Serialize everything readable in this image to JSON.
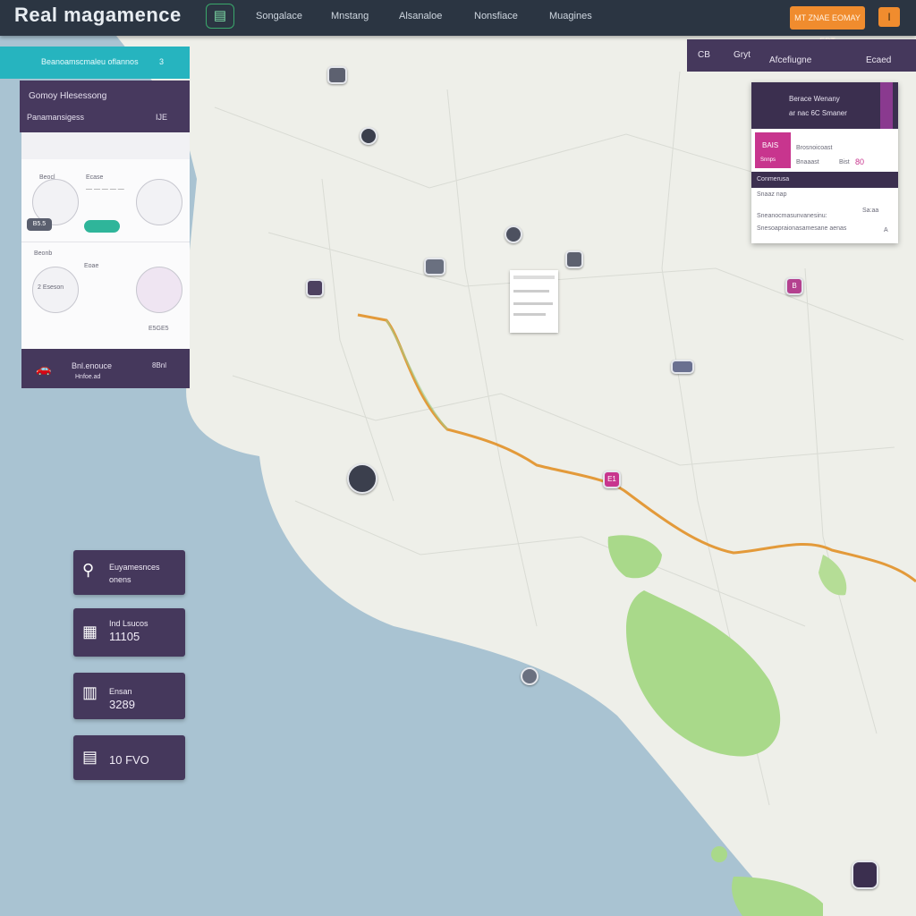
{
  "header": {
    "brand": "Real magamence",
    "nav": [
      "Songalace",
      "Mnstang",
      "Alsanaloe",
      "Nonsfiace",
      "Muagines"
    ],
    "cta_label": "MT ZNAE EOMAY ERT",
    "secondary_label": "I"
  },
  "left_panel": {
    "header_text": "Beanoamscmaleu oflannos",
    "header_num": "3",
    "title": "Gomoy Hlesessong",
    "subtitle": "Panamansigess",
    "subtitle_num": "IJE",
    "row1_text": "Beocl",
    "row1_item": "Ecase",
    "badge_label": "B5.5",
    "row2_text": "Beonb",
    "row2_item": "Eoae",
    "card_value1": "2 Eseson",
    "card_value2": "E5GE5",
    "footer_title": "Bnl.enouce",
    "footer_num": "8Bnl",
    "footer_sub": "Hnfoe.ad"
  },
  "stats": [
    {
      "icon": "map-pin-icon",
      "label": "Euyamesnces",
      "value": "onens"
    },
    {
      "icon": "store-icon",
      "label": "Ind Lsucos",
      "value": "11105"
    },
    {
      "icon": "calendar-icon",
      "label": "Ensan",
      "value": "3289"
    },
    {
      "icon": "building-icon",
      "label": "",
      "value": "10 FVO"
    }
  ],
  "right_top": {
    "item1": "CB",
    "item2": "Gryt",
    "item3": "Afcefiugne",
    "item4": "Ecaed"
  },
  "right_card": {
    "header1": "Berace Wenany",
    "header2": "ar nac 6C Smaner",
    "tag": "BAIS",
    "tag_sub": "Snnps",
    "field1": "Brosnoicoast",
    "field2": "Bnaaast",
    "field3": "Bist",
    "field_num": "80",
    "bar_label": "Conmerusa",
    "row1": "Snaaz nap",
    "row2": "Sneanocmasunvanesinu:",
    "row2_val": "Sa:aa",
    "row3": "Snesoapraionasamesane aenas",
    "row3_val": "A"
  },
  "markers": [
    {
      "label": "E1",
      "color": "#c8358e"
    },
    {
      "label": "B",
      "color": "#b4418f"
    }
  ],
  "colors": {
    "accent_teal": "#26b4bf",
    "purple_dark": "#45385c",
    "orange": "#f08c2e",
    "route": "#e39a3a",
    "water": "#a9c3d2",
    "land": "#eeefe9",
    "park": "#a9d98a"
  }
}
